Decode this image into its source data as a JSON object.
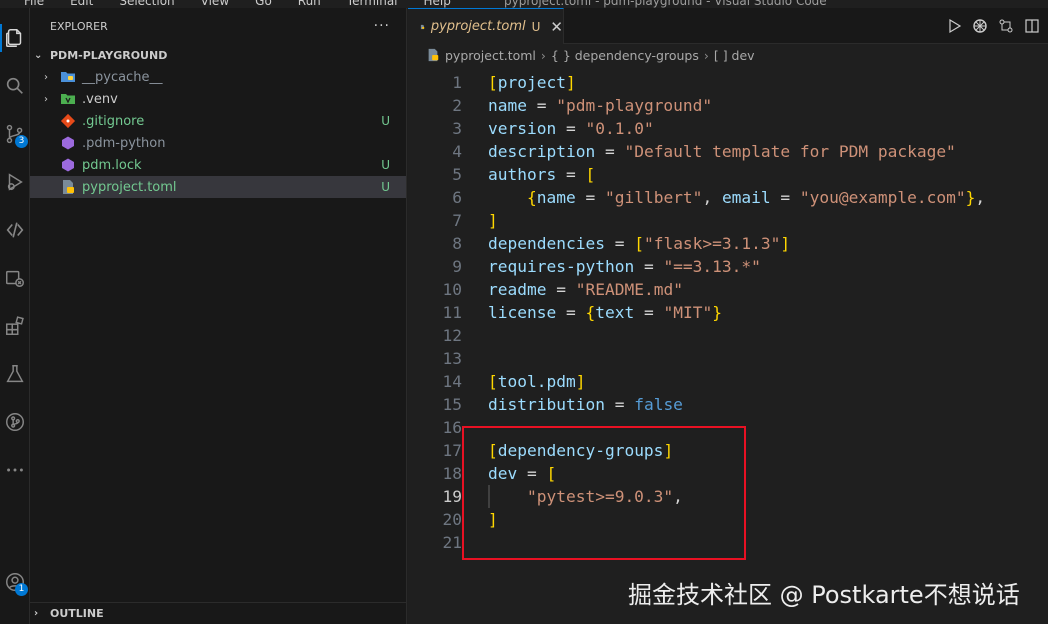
{
  "window": {
    "title": "pyproject.toml - pdm-playground - Visual Studio Code",
    "menu": [
      "File",
      "Edit",
      "Selection",
      "View",
      "Go",
      "Run",
      "Terminal",
      "Help"
    ]
  },
  "activity_bar": {
    "items": [
      {
        "name": "explorer-icon"
      },
      {
        "name": "search-icon"
      },
      {
        "name": "source-control-icon",
        "badge": "3"
      },
      {
        "name": "run-debug-icon"
      },
      {
        "name": "remote-icon"
      },
      {
        "name": "containers-icon"
      },
      {
        "name": "extensions-icon"
      },
      {
        "name": "testing-icon"
      },
      {
        "name": "git-graph-icon"
      },
      {
        "name": "more-icon"
      }
    ],
    "accounts_badge": "1"
  },
  "sidebar": {
    "title": "EXPLORER",
    "more": "···",
    "project": "PDM-PLAYGROUND",
    "files": [
      {
        "name": "__pycache__",
        "icon": "folder-python-icon",
        "expandable": true,
        "git": ""
      },
      {
        "name": ".venv",
        "icon": "folder-venv-icon",
        "expandable": true,
        "git": ""
      },
      {
        "name": ".gitignore",
        "icon": "git-icon",
        "expandable": false,
        "git": "U"
      },
      {
        "name": ".pdm-python",
        "icon": "pdm-icon",
        "expandable": false,
        "git": ""
      },
      {
        "name": "pdm.lock",
        "icon": "pdm-icon",
        "expandable": false,
        "git": "U"
      },
      {
        "name": "pyproject.toml",
        "icon": "toml-icon",
        "expandable": false,
        "git": "U"
      }
    ],
    "outline": "OUTLINE"
  },
  "editor": {
    "tab": {
      "name": "pyproject.toml",
      "status": "U",
      "close": "✕"
    },
    "breadcrumbs": [
      "pyproject.toml",
      "{ } dependency-groups",
      "[ ] dev"
    ],
    "lines": [
      "[project]",
      "name = \"pdm-playground\"",
      "version = \"0.1.0\"",
      "description = \"Default template for PDM package\"",
      "authors = [",
      "    {name = \"gillbert\", email = \"you@example.com\"},",
      "]",
      "dependencies = [\"flask>=3.1.3\"]",
      "requires-python = \"==3.13.*\"",
      "readme = \"README.md\"",
      "license = {text = \"MIT\"}",
      "",
      "",
      "[tool.pdm]",
      "distribution = false",
      "",
      "[dependency-groups]",
      "dev = [",
      "    \"pytest>=9.0.3\",",
      "]",
      ""
    ],
    "current_line": 19
  },
  "watermark": "掘金技术社区 @ Postkarte不想说话"
}
